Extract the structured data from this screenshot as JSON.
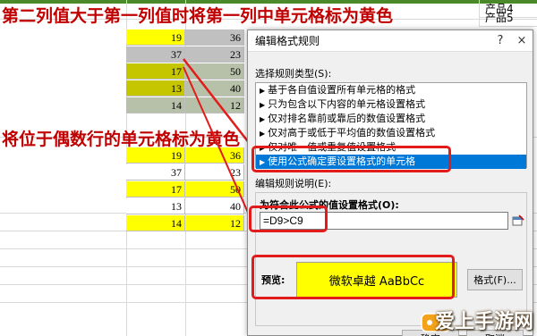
{
  "headings": {
    "top": "第二列值大于第一列值时将第一列中单元格标为黄色",
    "middle": "将位于偶数行的单元格标为黄色"
  },
  "right_column": [
    "产品4",
    "产品5"
  ],
  "table1": [
    {
      "a": "19",
      "b": "36",
      "a_fill": "yellow",
      "b_fill": "gray"
    },
    {
      "a": "37",
      "b": "23",
      "a_fill": "gray",
      "b_fill": "gray"
    },
    {
      "a": "17",
      "b": "50",
      "a_fill": "olive",
      "b_fill": "sel"
    },
    {
      "a": "13",
      "b": "40",
      "a_fill": "olive",
      "b_fill": "sel"
    },
    {
      "a": "14",
      "b": "12",
      "a_fill": "sel",
      "b_fill": "sel"
    }
  ],
  "table2": [
    {
      "a": "19",
      "b": "36",
      "a_fill": "yellow",
      "b_fill": "yellow"
    },
    {
      "a": "37",
      "b": "23",
      "a_fill": "white",
      "b_fill": "white"
    },
    {
      "a": "17",
      "b": "50",
      "a_fill": "yellow",
      "b_fill": "yellow"
    },
    {
      "a": "13",
      "b": "40",
      "a_fill": "white",
      "b_fill": "white"
    },
    {
      "a": "14",
      "b": "12",
      "a_fill": "yellow",
      "b_fill": "yellow"
    }
  ],
  "dialog": {
    "title": "编辑格式规则",
    "help": "?",
    "close": "×",
    "select_type_label": "选择规则类型(S):",
    "rule_types": [
      "基于各自值设置所有单元格的格式",
      "只为包含以下内容的单元格设置格式",
      "仅对排名靠前或靠后的数值设置格式",
      "仅对高于或低于平均值的数值设置格式",
      "仅对唯一值或重复值设置格式",
      "使用公式确定要设置格式的单元格"
    ],
    "selected_rule_index": 5,
    "edit_desc_label": "编辑规则说明(E):",
    "formula_label": "为符合此公式的值设置格式(O):",
    "formula_value": "=D9>C9",
    "preview_label": "预览:",
    "preview_text": "微软卓越  AaBbCc",
    "format_button": "格式(F)...",
    "ok_button": "确定",
    "cancel_button": "取消"
  },
  "watermark": "爱上手游网",
  "colors": {
    "heading": "#c00000",
    "highlight": "#ffff00",
    "annotation": "#e21b1b",
    "selection": "#0078d7"
  }
}
